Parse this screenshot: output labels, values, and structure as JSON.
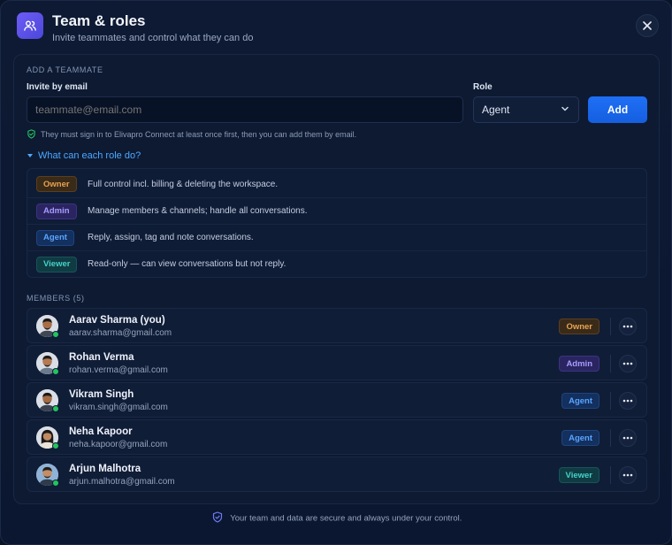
{
  "header": {
    "title": "Team & roles",
    "subtitle": "Invite teammates and control what they can do",
    "icon": "users-icon",
    "close_icon": "close-icon"
  },
  "invite": {
    "section_label": "ADD A TEAMMATE",
    "email_label": "Invite by email",
    "email_placeholder": "teammate@email.com",
    "role_label": "Role",
    "role_value": "Agent",
    "add_label": "Add",
    "hint": "They must sign in to Elivapro Connect at least once first, then you can add them by email.",
    "roles_toggle": "What can each role do?"
  },
  "roles": [
    {
      "name": "Owner",
      "class": "b-owner",
      "desc": "Full control incl. billing & deleting the workspace."
    },
    {
      "name": "Admin",
      "class": "b-admin",
      "desc": "Manage members & channels; handle all conversations."
    },
    {
      "name": "Agent",
      "class": "b-agent",
      "desc": "Reply, assign, tag and note conversations."
    },
    {
      "name": "Viewer",
      "class": "b-viewer",
      "desc": "Read-only — can view conversations but not reply."
    }
  ],
  "members": {
    "section_label": "MEMBERS (5)",
    "items": [
      {
        "name": "Aarav Sharma (you)",
        "email": "aarav.sharma@gmail.com",
        "role": "Owner",
        "class": "b-owner",
        "online": true
      },
      {
        "name": "Rohan Verma",
        "email": "rohan.verma@gmail.com",
        "role": "Admin",
        "class": "b-admin",
        "online": true
      },
      {
        "name": "Vikram Singh",
        "email": "vikram.singh@gmail.com",
        "role": "Agent",
        "class": "b-agent",
        "online": true
      },
      {
        "name": "Neha Kapoor",
        "email": "neha.kapoor@gmail.com",
        "role": "Agent",
        "class": "b-agent",
        "online": true
      },
      {
        "name": "Arjun Malhotra",
        "email": "arjun.malhotra@gmail.com",
        "role": "Viewer",
        "class": "b-viewer",
        "online": true
      }
    ]
  },
  "footer": {
    "text": "Your team and data are secure and always under your control.",
    "icon": "shield-icon"
  },
  "colors": {
    "accent": "#1f6ff5",
    "link": "#4ea8ff",
    "online": "#22c55e",
    "background": "#0a1428"
  }
}
